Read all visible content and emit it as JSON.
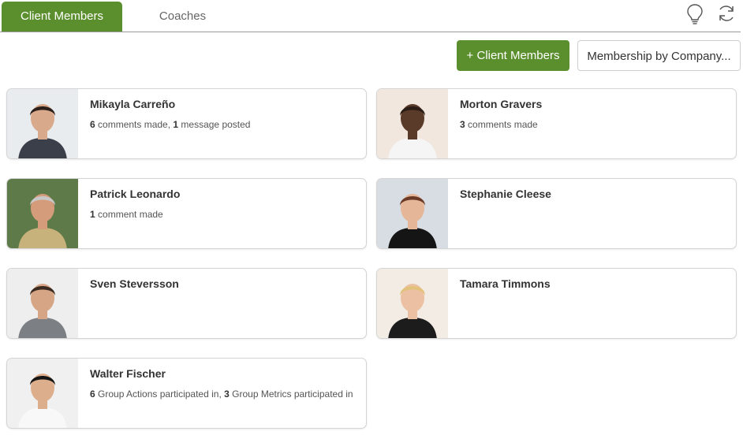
{
  "tabs": [
    {
      "label": "Client Members",
      "active": true
    },
    {
      "label": "Coaches",
      "active": false
    }
  ],
  "icons": {
    "hint": "lightbulb-icon",
    "refresh": "refresh-icon"
  },
  "actions": {
    "add_label": "+ Client Members",
    "membership_label": "Membership by Company..."
  },
  "colors": {
    "accent": "#5b8f2d",
    "border": "#d4d4d4"
  },
  "members": [
    {
      "name": "Mikayla Carreño",
      "stats": [
        {
          "count": "6",
          "text": " comments made, "
        },
        {
          "count": "1",
          "text": " message posted"
        }
      ]
    },
    {
      "name": "Morton Gravers",
      "stats": [
        {
          "count": "3",
          "text": " comments made"
        }
      ]
    },
    {
      "name": "Patrick Leonardo",
      "stats": [
        {
          "count": "1",
          "text": " comment made"
        }
      ]
    },
    {
      "name": "Stephanie Cleese",
      "stats": []
    },
    {
      "name": "Sven Steversson",
      "stats": []
    },
    {
      "name": "Tamara Timmons",
      "stats": []
    },
    {
      "name": "Walter Fischer",
      "stats": [
        {
          "count": "6",
          "text": " Group Actions participated in, "
        },
        {
          "count": "3",
          "text": " Group Metrics participated in"
        }
      ]
    }
  ]
}
